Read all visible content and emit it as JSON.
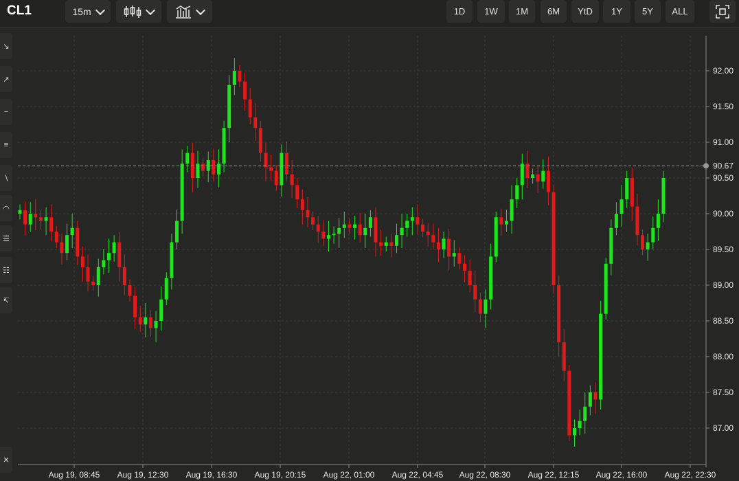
{
  "symbol": "CL1",
  "interval": {
    "label": "15m"
  },
  "ranges": [
    "1D",
    "1W",
    "1M",
    "6M",
    "YtD",
    "1Y",
    "5Y",
    "ALL"
  ],
  "icons": {
    "chart_type": "candlestick-icon",
    "indicators": "indicators-icon",
    "fullscreen": "fullscreen-icon"
  },
  "colors": {
    "up": "#1ee51e",
    "down": "#e31a1a",
    "background": "#262725",
    "grid": "#3c3d3b"
  },
  "chart_data": {
    "type": "candlestick",
    "ylim": [
      86.6,
      92.5
    ],
    "yticks": [
      87.0,
      87.5,
      88.0,
      88.5,
      89.0,
      89.5,
      90.0,
      90.5,
      91.0,
      91.5,
      92.0
    ],
    "ytick_labels": [
      "87.00",
      "87.50",
      "88.00",
      "88.50",
      "89.00",
      "89.50",
      "90.00",
      "90.50",
      "91.00",
      "91.50",
      "92.00"
    ],
    "xtick_labels": [
      "Aug 19, 08:45",
      "Aug 19, 12:30",
      "Aug 19, 16:30",
      "Aug 19, 20:15",
      "Aug 22, 01:00",
      "Aug 22, 04:45",
      "Aug 22, 08:30",
      "Aug 22, 12:15",
      "Aug 22, 16:00",
      "Aug 22, 22:30"
    ],
    "last_price": 90.67,
    "last_price_label": "90.67",
    "grid": true,
    "closes": [
      90.05,
      89.85,
      90.0,
      89.95,
      89.9,
      89.95,
      89.75,
      89.6,
      89.45,
      89.7,
      89.8,
      89.4,
      89.25,
      89.05,
      89.0,
      89.25,
      89.35,
      89.45,
      89.6,
      89.25,
      89.0,
      88.85,
      88.55,
      88.45,
      88.55,
      88.4,
      88.5,
      88.8,
      89.1,
      89.6,
      89.9,
      90.7,
      90.85,
      90.5,
      90.7,
      90.6,
      90.75,
      90.55,
      90.7,
      91.2,
      91.8,
      92.0,
      91.85,
      91.6,
      91.35,
      91.2,
      90.85,
      90.65,
      90.6,
      90.4,
      90.85,
      90.55,
      90.4,
      90.2,
      90.05,
      89.95,
      89.85,
      89.75,
      89.65,
      89.7,
      89.72,
      89.8,
      89.85,
      89.8,
      89.85,
      89.7,
      89.8,
      89.95,
      89.6,
      89.55,
      89.6,
      89.55,
      89.7,
      89.8,
      89.9,
      89.95,
      89.85,
      89.75,
      89.7,
      89.6,
      89.5,
      89.65,
      89.4,
      89.45,
      89.3,
      89.2,
      89.0,
      88.8,
      88.6,
      88.8,
      89.4,
      89.95,
      89.85,
      89.9,
      90.2,
      90.4,
      90.7,
      90.5,
      90.55,
      90.45,
      90.6,
      90.3,
      89.0,
      88.2,
      87.8,
      86.9,
      87.0,
      87.1,
      87.3,
      87.5,
      87.4,
      88.6,
      89.3,
      89.8,
      90.0,
      90.2,
      90.5,
      90.1,
      89.7,
      89.5,
      89.6,
      89.8,
      90.0,
      90.5
    ]
  }
}
